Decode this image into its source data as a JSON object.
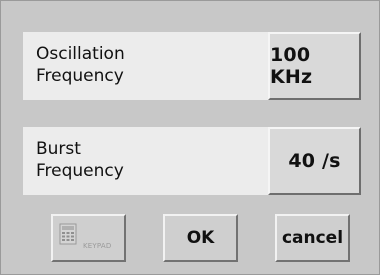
{
  "oscillation": {
    "label": "Oscillation\nFrequency",
    "value": "100 KHz"
  },
  "burst": {
    "label": "Burst\nFrequency",
    "value": "40 /s"
  },
  "buttons": {
    "keypad_label": "KEYPAD",
    "ok_label": "OK",
    "cancel_label": "cancel"
  },
  "icons": {
    "keypad": "keypad-icon"
  },
  "colors": {
    "background": "#c8c8c8",
    "row_background": "#ececec",
    "button_face": "#d9d9d9",
    "disabled_text": "#9a9a9a"
  }
}
